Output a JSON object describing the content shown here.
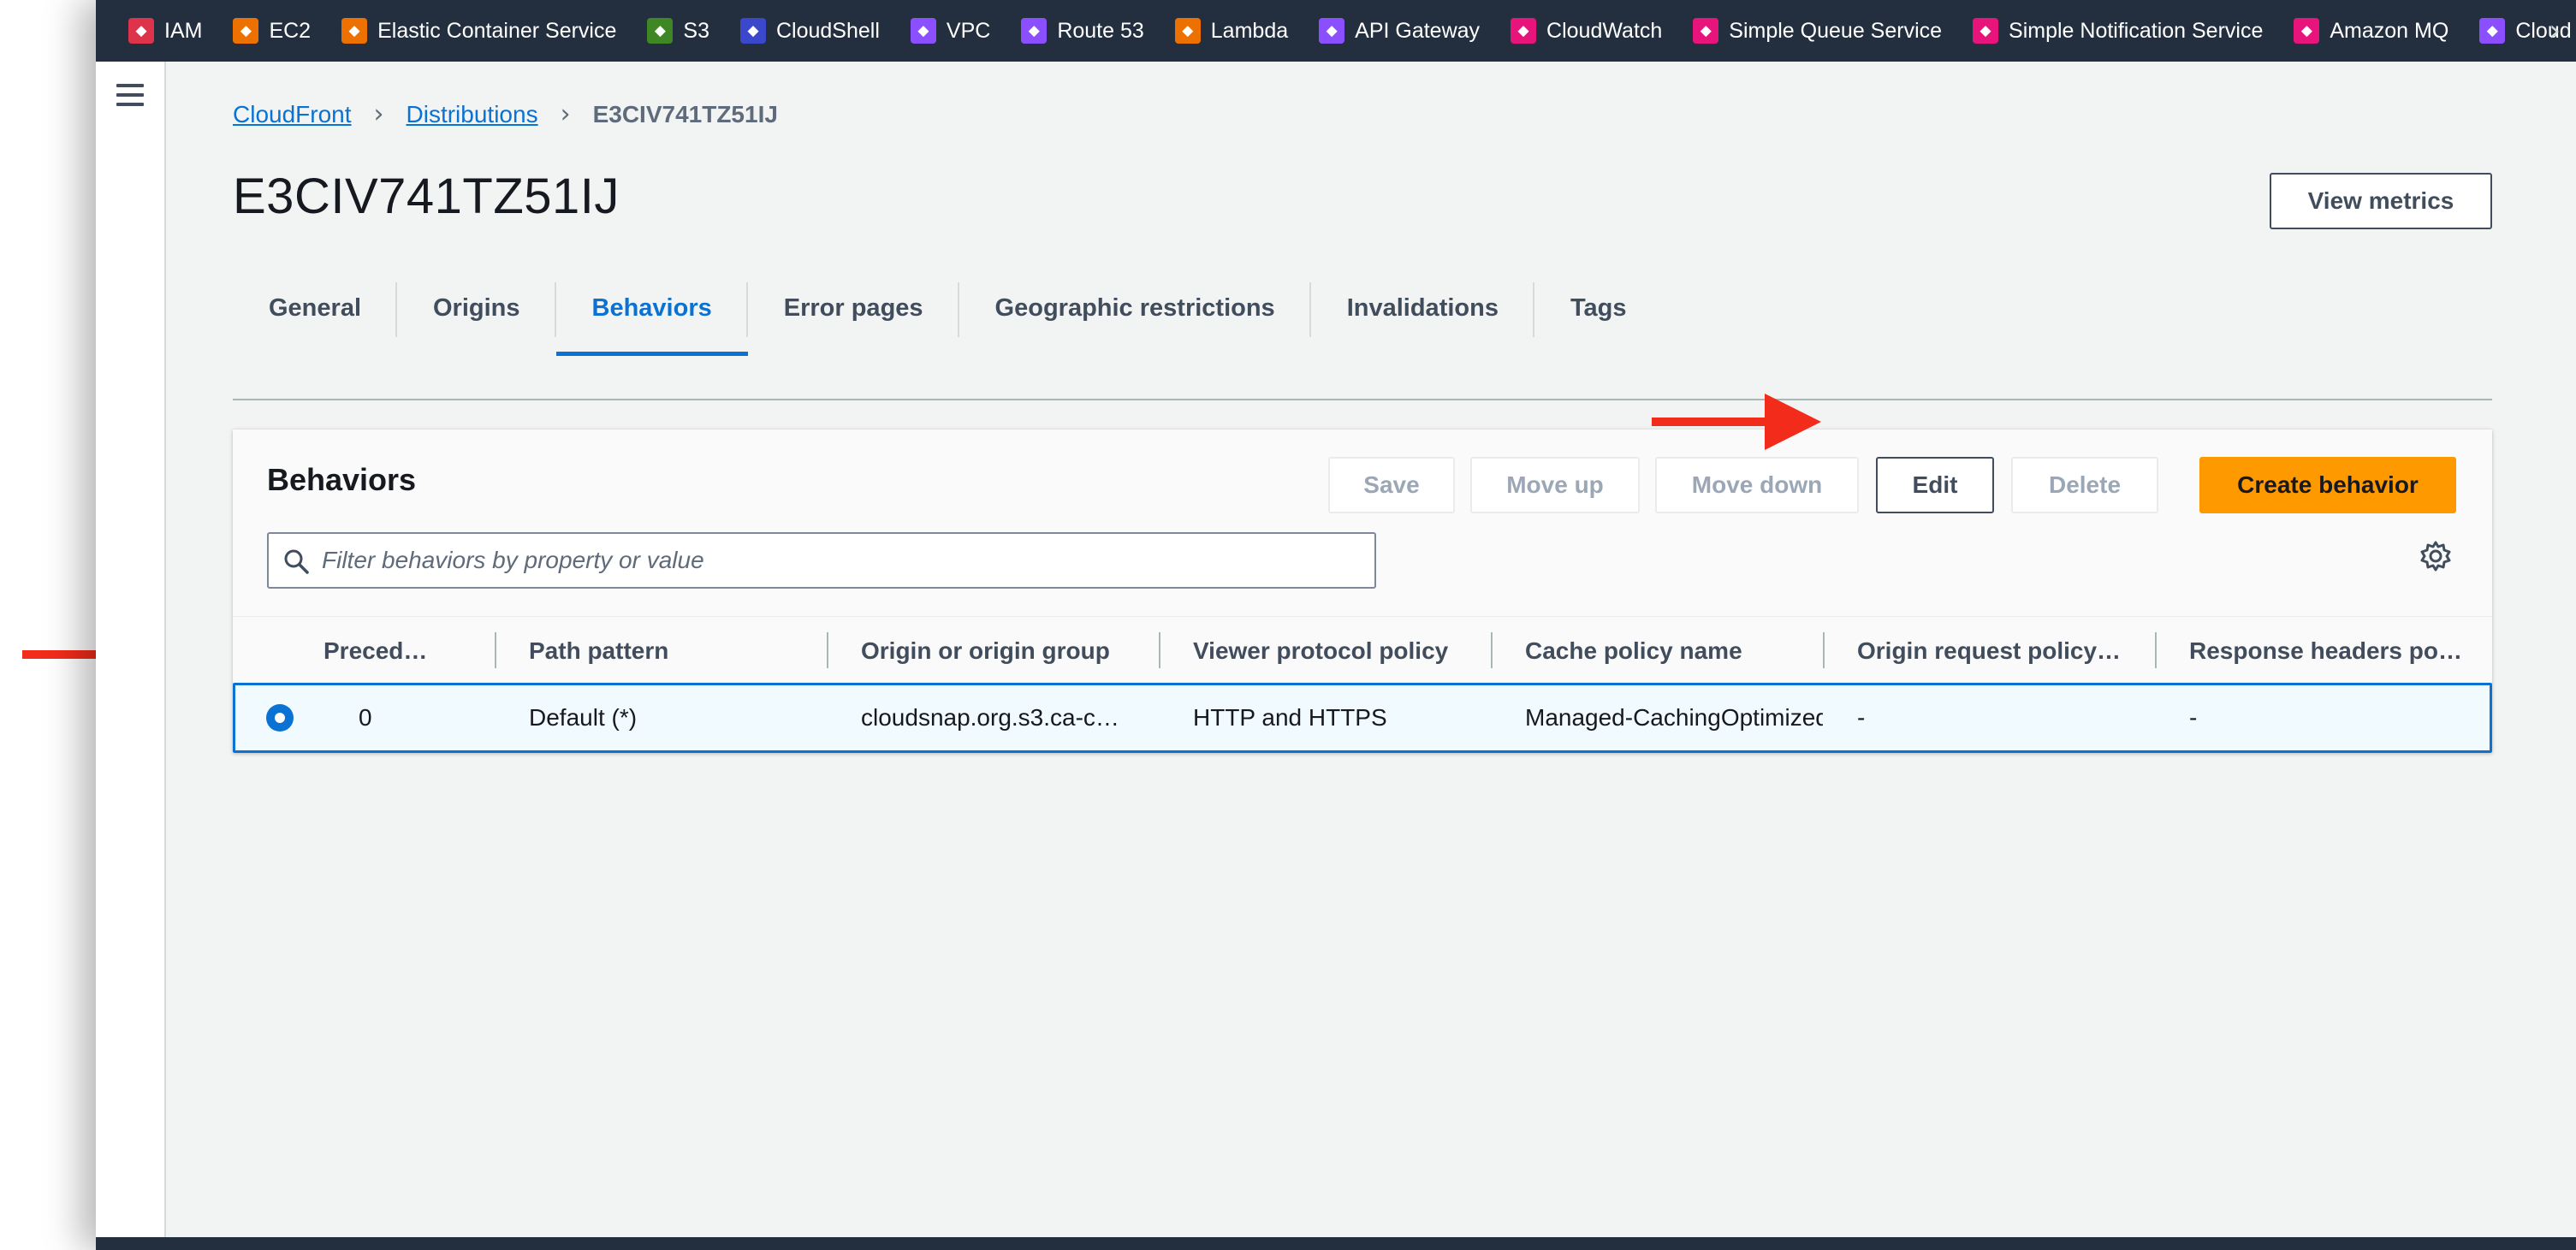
{
  "services": [
    {
      "label": "IAM",
      "icon": "iam-icon",
      "color": "#dd344c"
    },
    {
      "label": "EC2",
      "icon": "ec2-icon",
      "color": "#ed7100"
    },
    {
      "label": "Elastic Container Service",
      "icon": "ecs-icon",
      "color": "#ed7100"
    },
    {
      "label": "S3",
      "icon": "s3-icon",
      "color": "#3f8624"
    },
    {
      "label": "CloudShell",
      "icon": "cloudshell-icon",
      "color": "#3b48cc"
    },
    {
      "label": "VPC",
      "icon": "vpc-icon",
      "color": "#8c4fff"
    },
    {
      "label": "Route 53",
      "icon": "route53-icon",
      "color": "#8c4fff"
    },
    {
      "label": "Lambda",
      "icon": "lambda-icon",
      "color": "#ed7100"
    },
    {
      "label": "API Gateway",
      "icon": "api-gateway-icon",
      "color": "#8c4fff"
    },
    {
      "label": "CloudWatch",
      "icon": "cloudwatch-icon",
      "color": "#e7157b"
    },
    {
      "label": "Simple Queue Service",
      "icon": "sqs-icon",
      "color": "#e7157b"
    },
    {
      "label": "Simple Notification Service",
      "icon": "sns-icon",
      "color": "#e7157b"
    },
    {
      "label": "Amazon MQ",
      "icon": "mq-icon",
      "color": "#e7157b"
    },
    {
      "label": "Cloud",
      "icon": "cloud-service-icon",
      "color": "#8c4fff"
    }
  ],
  "breadcrumb": {
    "root": "CloudFront",
    "parent": "Distributions",
    "current": "E3CIV741TZ51IJ"
  },
  "page": {
    "title": "E3CIV741TZ51IJ",
    "view_metrics": "View metrics"
  },
  "tabs": [
    "General",
    "Origins",
    "Behaviors",
    "Error pages",
    "Geographic restrictions",
    "Invalidations",
    "Tags"
  ],
  "active_tab": "Behaviors",
  "behaviors": {
    "title": "Behaviors",
    "buttons": {
      "save": "Save",
      "move_up": "Move up",
      "move_down": "Move down",
      "edit": "Edit",
      "delete": "Delete",
      "create": "Create behavior"
    },
    "filter_placeholder": "Filter behaviors by property or value",
    "columns": [
      "Preced…",
      "Path pattern",
      "Origin or origin group",
      "Viewer protocol policy",
      "Cache policy name",
      "Origin request policy…",
      "Response headers po…"
    ],
    "rows": [
      {
        "selected": true,
        "precedence": "0",
        "path_pattern": "Default (*)",
        "origin": "cloudsnap.org.s3.ca-c…",
        "viewer_protocol": "HTTP and HTTPS",
        "cache_policy": "Managed-CachingOptimized",
        "origin_request_policy": "-",
        "response_headers_policy": "-"
      }
    ]
  },
  "colors": {
    "topbar": "#232f3e",
    "link": "#0972d3",
    "primary_button": "#ff9900",
    "annotation_arrow": "#f22b1a"
  }
}
